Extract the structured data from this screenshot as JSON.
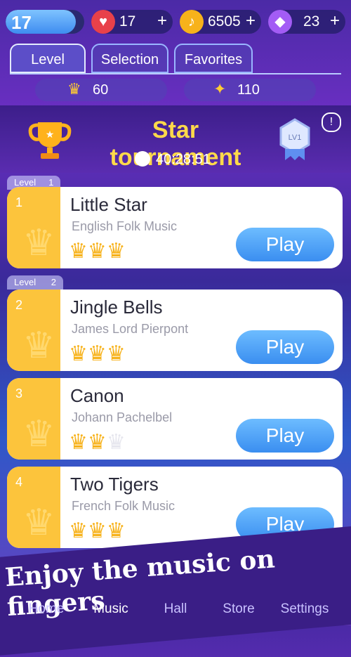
{
  "player": {
    "level": "17"
  },
  "stats": [
    {
      "icon": "heart-icon",
      "value": "17",
      "color": "#e8414a",
      "glyph": "♥"
    },
    {
      "icon": "note-icon",
      "value": "6505",
      "color": "#f7b21b",
      "glyph": "♪"
    },
    {
      "icon": "diamond-icon",
      "value": "23",
      "color": "#a35cf5",
      "glyph": "◆"
    }
  ],
  "plus_label": "+",
  "tabs": [
    "Level",
    "Selection",
    "Favorites"
  ],
  "counts": [
    {
      "icon": "crown-icon",
      "glyph": "♛",
      "value": "60"
    },
    {
      "icon": "star-icon",
      "glyph": "✦",
      "value": "110"
    }
  ],
  "tournament": {
    "title": "Star tournament",
    "timer": "40:28:51",
    "badge": "LV1",
    "info": "!"
  },
  "level_labels": [
    {
      "text": "Level",
      "num": "1"
    },
    {
      "text": "Level",
      "num": "2"
    }
  ],
  "songs": [
    {
      "num": "1",
      "title": "Little Star",
      "artist": "English Folk Music",
      "crowns_earned": 3,
      "play": "Play"
    },
    {
      "num": "2",
      "title": "Jingle Bells",
      "artist": "James Lord Pierpont",
      "crowns_earned": 3,
      "play": "Play"
    },
    {
      "num": "3",
      "title": "Canon",
      "artist": "Johann Pachelbel",
      "crowns_earned": 2,
      "play": "Play"
    },
    {
      "num": "4",
      "title": "Two Tigers",
      "artist": "French Folk Music",
      "crowns_earned": 3,
      "play": "Play"
    }
  ],
  "promo": "Enjoy the music on fingers",
  "nav": [
    "Home",
    "Music",
    "Hall",
    "Store",
    "Settings"
  ],
  "colors": {
    "accent_yellow": "#fcc43c",
    "play_blue": "#3a8ef0",
    "title_gold": "#ffd94a"
  }
}
